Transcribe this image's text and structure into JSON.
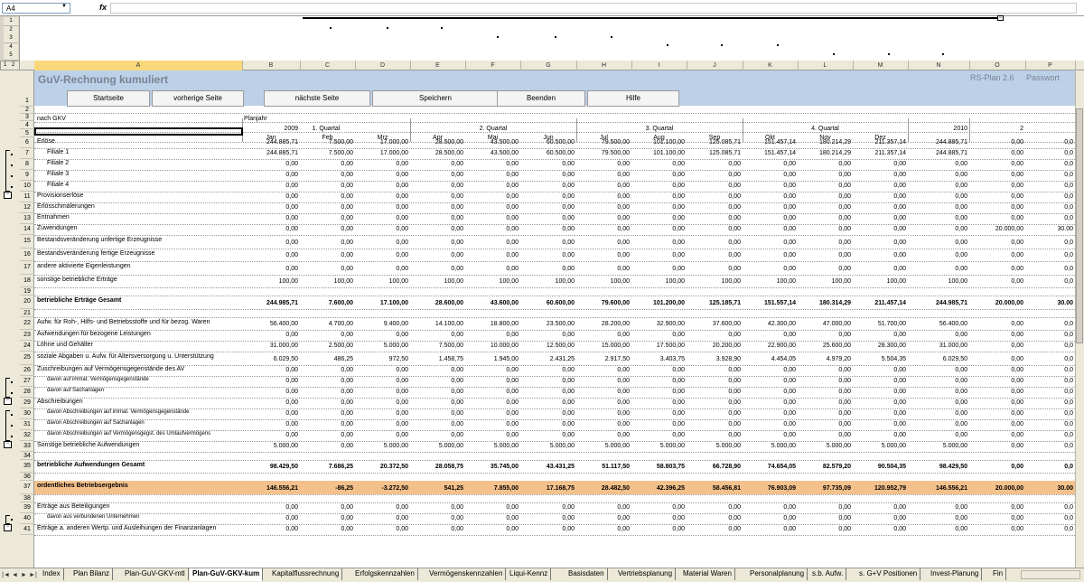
{
  "formula_bar": {
    "cell_ref": "A4",
    "fx": "fx",
    "value": ""
  },
  "outline": {
    "row_levels": [
      "1",
      "2",
      "3",
      "4",
      "5"
    ],
    "level_buttons": [
      "1",
      "2"
    ]
  },
  "columns": [
    "A",
    "B",
    "C",
    "D",
    "E",
    "F",
    "G",
    "H",
    "I",
    "J",
    "K",
    "L",
    "M",
    "N",
    "O",
    "P"
  ],
  "selected_column": "A",
  "banner": {
    "title": "GuV-Rechnung kumuliert",
    "version": "RS-Plan 2.6",
    "password": "Passwort",
    "buttons": [
      "Startseite",
      "vorherige Seite",
      "nächste Seite",
      "Speichern",
      "Beenden",
      "Hilfe"
    ]
  },
  "header": {
    "gkv": "nach GKV",
    "planjahr": "Planjahr",
    "year": "2009",
    "next_year": "2010",
    "next_year_cut": "2",
    "quarters": [
      "1. Quartal",
      "2. Quartal",
      "3. Quartal",
      "4. Quartal"
    ],
    "months": [
      "Jan",
      "Feb",
      "Mrz",
      "Apr",
      "Mai",
      "Jun",
      "Jul",
      "Aug",
      "Sep",
      "Okt",
      "Nov",
      "Dez"
    ]
  },
  "rows": [
    {
      "n": "6",
      "label": "Erlöse",
      "v": [
        "244.885,71",
        "7.500,00",
        "17.000,00",
        "28.500,00",
        "43.500,00",
        "60.500,00",
        "79.500,00",
        "101.100,00",
        "125.085,71",
        "151.457,14",
        "180.214,29",
        "211.357,14",
        "244.885,71",
        "0,00",
        "0,0"
      ]
    },
    {
      "n": "7",
      "label": "Filiale 1",
      "indent": 1,
      "v": [
        "244.885,71",
        "7.500,00",
        "17.000,00",
        "28.500,00",
        "43.500,00",
        "60.500,00",
        "79.500,00",
        "101.100,00",
        "125.085,71",
        "151.457,14",
        "180.214,29",
        "211.357,14",
        "244.885,71",
        "0,00",
        "0,0"
      ]
    },
    {
      "n": "8",
      "label": "Filiale 2",
      "indent": 1,
      "v": [
        "0,00",
        "0,00",
        "0,00",
        "0,00",
        "0,00",
        "0,00",
        "0,00",
        "0,00",
        "0,00",
        "0,00",
        "0,00",
        "0,00",
        "0,00",
        "0,00",
        "0,0"
      ]
    },
    {
      "n": "9",
      "label": "Filiale 3",
      "indent": 1,
      "v": [
        "0,00",
        "0,00",
        "0,00",
        "0,00",
        "0,00",
        "0,00",
        "0,00",
        "0,00",
        "0,00",
        "0,00",
        "0,00",
        "0,00",
        "0,00",
        "0,00",
        "0,0"
      ]
    },
    {
      "n": "10",
      "label": "Filiale 4",
      "indent": 1,
      "v": [
        "0,00",
        "0,00",
        "0,00",
        "0,00",
        "0,00",
        "0,00",
        "0,00",
        "0,00",
        "0,00",
        "0,00",
        "0,00",
        "0,00",
        "0,00",
        "0,00",
        "0,0"
      ]
    },
    {
      "n": "11",
      "label": "Provisionserlöse",
      "v": [
        "0,00",
        "0,00",
        "0,00",
        "0,00",
        "0,00",
        "0,00",
        "0,00",
        "0,00",
        "0,00",
        "0,00",
        "0,00",
        "0,00",
        "0,00",
        "0,00",
        "0,0"
      ]
    },
    {
      "n": "12",
      "label": "Erlösschmälerungen",
      "v": [
        "0,00",
        "0,00",
        "0,00",
        "0,00",
        "0,00",
        "0,00",
        "0,00",
        "0,00",
        "0,00",
        "0,00",
        "0,00",
        "0,00",
        "0,00",
        "0,00",
        "0,0"
      ]
    },
    {
      "n": "13",
      "label": "Entnahmen",
      "v": [
        "0,00",
        "0,00",
        "0,00",
        "0,00",
        "0,00",
        "0,00",
        "0,00",
        "0,00",
        "0,00",
        "0,00",
        "0,00",
        "0,00",
        "0,00",
        "0,00",
        "0,0"
      ]
    },
    {
      "n": "14",
      "label": "Zuwendungen",
      "v": [
        "0,00",
        "0,00",
        "0,00",
        "0,00",
        "0,00",
        "0,00",
        "0,00",
        "0,00",
        "0,00",
        "0,00",
        "0,00",
        "0,00",
        "0,00",
        "20.000,00",
        "30.00"
      ]
    },
    {
      "n": "15",
      "label": "Bestandsveränderung unfertige Erzeugnisse",
      "v": [
        "0,00",
        "0,00",
        "0,00",
        "0,00",
        "0,00",
        "0,00",
        "0,00",
        "0,00",
        "0,00",
        "0,00",
        "0,00",
        "0,00",
        "0,00",
        "0,00",
        "0,0"
      ]
    },
    {
      "n": "16",
      "label": "Bestandsveränderung fertige Erzeugnisse",
      "v": [
        "0,00",
        "0,00",
        "0,00",
        "0,00",
        "0,00",
        "0,00",
        "0,00",
        "0,00",
        "0,00",
        "0,00",
        "0,00",
        "0,00",
        "0,00",
        "0,00",
        "0,0"
      ]
    },
    {
      "n": "17",
      "label": "andere aktivierte Eigenleistungen",
      "v": [
        "0,00",
        "0,00",
        "0,00",
        "0,00",
        "0,00",
        "0,00",
        "0,00",
        "0,00",
        "0,00",
        "0,00",
        "0,00",
        "0,00",
        "0,00",
        "0,00",
        "0,0"
      ]
    },
    {
      "n": "18",
      "label": "sonstige betriebliche Erträge",
      "v": [
        "100,00",
        "100,00",
        "100,00",
        "100,00",
        "100,00",
        "100,00",
        "100,00",
        "100,00",
        "100,00",
        "100,00",
        "100,00",
        "100,00",
        "100,00",
        "0,00",
        "0,0"
      ]
    },
    {
      "n": "19",
      "label": "",
      "v": []
    },
    {
      "n": "20",
      "label": "betriebliche Erträge Gesamt",
      "bold": true,
      "v": [
        "244.985,71",
        "7.600,00",
        "17.100,00",
        "28.600,00",
        "43.600,00",
        "60.600,00",
        "79.600,00",
        "101.200,00",
        "125.185,71",
        "151.557,14",
        "180.314,29",
        "211.457,14",
        "244.985,71",
        "20.000,00",
        "30.00"
      ]
    },
    {
      "n": "21",
      "label": "",
      "v": []
    },
    {
      "n": "22",
      "label": "Aufw. für Roh-, Hilfs- und Betriebsstoffe und für bezog. Waren",
      "v": [
        "56.400,00",
        "4.700,00",
        "9.400,00",
        "14.100,00",
        "18.800,00",
        "23.500,00",
        "28.200,00",
        "32.900,00",
        "37.600,00",
        "42.300,00",
        "47.000,00",
        "51.700,00",
        "56.400,00",
        "0,00",
        "0,0"
      ]
    },
    {
      "n": "23",
      "label": "Aufwendungen für bezogene Leistungen",
      "v": [
        "0,00",
        "0,00",
        "0,00",
        "0,00",
        "0,00",
        "0,00",
        "0,00",
        "0,00",
        "0,00",
        "0,00",
        "0,00",
        "0,00",
        "0,00",
        "0,00",
        "0,0"
      ]
    },
    {
      "n": "24",
      "label": "Löhne und Gehälter",
      "v": [
        "31.000,00",
        "2.500,00",
        "5.000,00",
        "7.500,00",
        "10.000,00",
        "12.500,00",
        "15.000,00",
        "17.500,00",
        "20.200,00",
        "22.900,00",
        "25.600,00",
        "28.300,00",
        "31.000,00",
        "0,00",
        "0,0"
      ]
    },
    {
      "n": "25",
      "label": "soziale Abgaben u. Aufw. für Altersversorgung u. Unterstützung",
      "v": [
        "6.029,50",
        "486,25",
        "972,50",
        "1.458,75",
        "1.945,00",
        "2.431,25",
        "2.917,50",
        "3.403,75",
        "3.928,90",
        "4.454,05",
        "4.979,20",
        "5.504,35",
        "6.029,50",
        "0,00",
        "0,0"
      ]
    },
    {
      "n": "26",
      "label": "Zuschreibungen auf Vermögensgegenstände des AV",
      "v": [
        "0,00",
        "0,00",
        "0,00",
        "0,00",
        "0,00",
        "0,00",
        "0,00",
        "0,00",
        "0,00",
        "0,00",
        "0,00",
        "0,00",
        "0,00",
        "0,00",
        "0,0"
      ]
    },
    {
      "n": "27",
      "label": "davon auf immat. Vermögensgegenstände",
      "small": true,
      "indent": 1,
      "v": [
        "0,00",
        "0,00",
        "0,00",
        "0,00",
        "0,00",
        "0,00",
        "0,00",
        "0,00",
        "0,00",
        "0,00",
        "0,00",
        "0,00",
        "0,00",
        "0,00",
        "0,0"
      ]
    },
    {
      "n": "28",
      "label": "davon auf Sachanlagen",
      "small": true,
      "indent": 1,
      "v": [
        "0,00",
        "0,00",
        "0,00",
        "0,00",
        "0,00",
        "0,00",
        "0,00",
        "0,00",
        "0,00",
        "0,00",
        "0,00",
        "0,00",
        "0,00",
        "0,00",
        "0,0"
      ]
    },
    {
      "n": "29",
      "label": "Abschreibungen",
      "v": [
        "0,00",
        "0,00",
        "0,00",
        "0,00",
        "0,00",
        "0,00",
        "0,00",
        "0,00",
        "0,00",
        "0,00",
        "0,00",
        "0,00",
        "0,00",
        "0,00",
        "0,0"
      ]
    },
    {
      "n": "30",
      "label": "davon Abschreibungen auf immat. Vermögensgegenstände",
      "small": true,
      "indent": 1,
      "v": [
        "0,00",
        "0,00",
        "0,00",
        "0,00",
        "0,00",
        "0,00",
        "0,00",
        "0,00",
        "0,00",
        "0,00",
        "0,00",
        "0,00",
        "0,00",
        "0,00",
        "0,0"
      ]
    },
    {
      "n": "31",
      "label": "davon Abschreibungen auf Sachanlagen",
      "small": true,
      "indent": 1,
      "v": [
        "0,00",
        "0,00",
        "0,00",
        "0,00",
        "0,00",
        "0,00",
        "0,00",
        "0,00",
        "0,00",
        "0,00",
        "0,00",
        "0,00",
        "0,00",
        "0,00",
        "0,0"
      ]
    },
    {
      "n": "32",
      "label": "davon Abschreibungen auf Vermögensgegst. des Umlaufvermögens",
      "small": true,
      "indent": 1,
      "v": [
        "0,00",
        "0,00",
        "0,00",
        "0,00",
        "0,00",
        "0,00",
        "0,00",
        "0,00",
        "0,00",
        "0,00",
        "0,00",
        "0,00",
        "0,00",
        "0,00",
        "0,0"
      ]
    },
    {
      "n": "33",
      "label": "Sonstige betriebliche Aufwendungen",
      "v": [
        "5.000,00",
        "0,00",
        "5.000,00",
        "5.000,00",
        "5.000,00",
        "5.000,00",
        "5.000,00",
        "5.000,00",
        "5.000,00",
        "5.000,00",
        "5.000,00",
        "5.000,00",
        "5.000,00",
        "0,00",
        "0,0"
      ]
    },
    {
      "n": "34",
      "label": "",
      "v": []
    },
    {
      "n": "35",
      "label": "betriebliche Aufwendungen Gesamt",
      "bold": true,
      "v": [
        "98.429,50",
        "7.686,25",
        "20.372,50",
        "28.058,75",
        "35.745,00",
        "43.431,25",
        "51.117,50",
        "58.803,75",
        "66.728,90",
        "74.654,05",
        "82.579,20",
        "90.504,35",
        "98.429,50",
        "0,00",
        "0,0"
      ]
    },
    {
      "n": "36",
      "label": "",
      "v": []
    },
    {
      "n": "37",
      "label": "ordentliches Betriebsergebnis",
      "bold": true,
      "hl": true,
      "v": [
        "146.556,21",
        "-86,25",
        "-3.272,50",
        "541,25",
        "7.855,00",
        "17.168,75",
        "28.482,50",
        "42.396,25",
        "58.456,81",
        "76.903,09",
        "97.735,09",
        "120.952,79",
        "146.556,21",
        "20.000,00",
        "30.00"
      ]
    },
    {
      "n": "38",
      "label": "",
      "v": []
    },
    {
      "n": "39",
      "label": "Erträge aus Beteiligungen",
      "v": [
        "0,00",
        "0,00",
        "0,00",
        "0,00",
        "0,00",
        "0,00",
        "0,00",
        "0,00",
        "0,00",
        "0,00",
        "0,00",
        "0,00",
        "0,00",
        "0,00",
        "0,0"
      ]
    },
    {
      "n": "40",
      "label": "davon aus verbundenen Unternehmen",
      "small": true,
      "indent": 1,
      "v": [
        "0,00",
        "0,00",
        "0,00",
        "0,00",
        "0,00",
        "0,00",
        "0,00",
        "0,00",
        "0,00",
        "0,00",
        "0,00",
        "0,00",
        "0,00",
        "0,00",
        "0,0"
      ]
    },
    {
      "n": "41",
      "label": "Erträge a. anderen Wertp. und Ausleihungen der Finanzanlagen",
      "v": [
        "0,00",
        "0,00",
        "0,00",
        "0,00",
        "0,00",
        "0,00",
        "0,00",
        "0,00",
        "0,00",
        "0,00",
        "0,00",
        "0,00",
        "0,00",
        "0,00",
        "0,0"
      ]
    }
  ],
  "tabs": [
    "Index",
    "Plan Bilanz",
    "Plan-GuV-GKV-mtl",
    "Plan-GuV-GKV-kum",
    "Kapitalflussrechnung",
    "Erfolgskennzahlen",
    "Vermögenskennzahlen",
    "Liqui-Kennz",
    "Basisdaten",
    "Vertriebsplanung",
    "Material Waren",
    "Personalplanung",
    "s.b. Aufw.",
    "s. G+V Positionen",
    "Invest-Planung",
    "Fin"
  ],
  "active_tab": "Plan-GuV-GKV-kum",
  "tab_nav": [
    "|◄",
    "◄",
    "►",
    "►|"
  ]
}
